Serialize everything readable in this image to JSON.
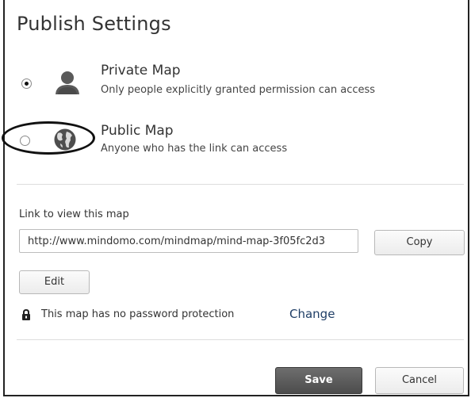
{
  "dialog": {
    "title": "Publish Settings"
  },
  "options": [
    {
      "title": "Private Map",
      "description": "Only people explicitly granted permission can access",
      "icon": "person-icon",
      "selected": true
    },
    {
      "title": "Public Map",
      "description": "Anyone who has the link can access",
      "icon": "globe-icon",
      "selected": false
    }
  ],
  "link": {
    "label": "Link to view this map",
    "url": "http://www.mindomo.com/mindmap/mind-map-3f05fc2d3",
    "copy_label": "Copy"
  },
  "edit_label": "Edit",
  "password": {
    "icon": "lock-icon",
    "text": "This map has no password protection",
    "change_label": "Change"
  },
  "footer": {
    "save_label": "Save",
    "cancel_label": "Cancel"
  },
  "colors": {
    "save_bg": "#555555",
    "link": "#1f3e66"
  }
}
